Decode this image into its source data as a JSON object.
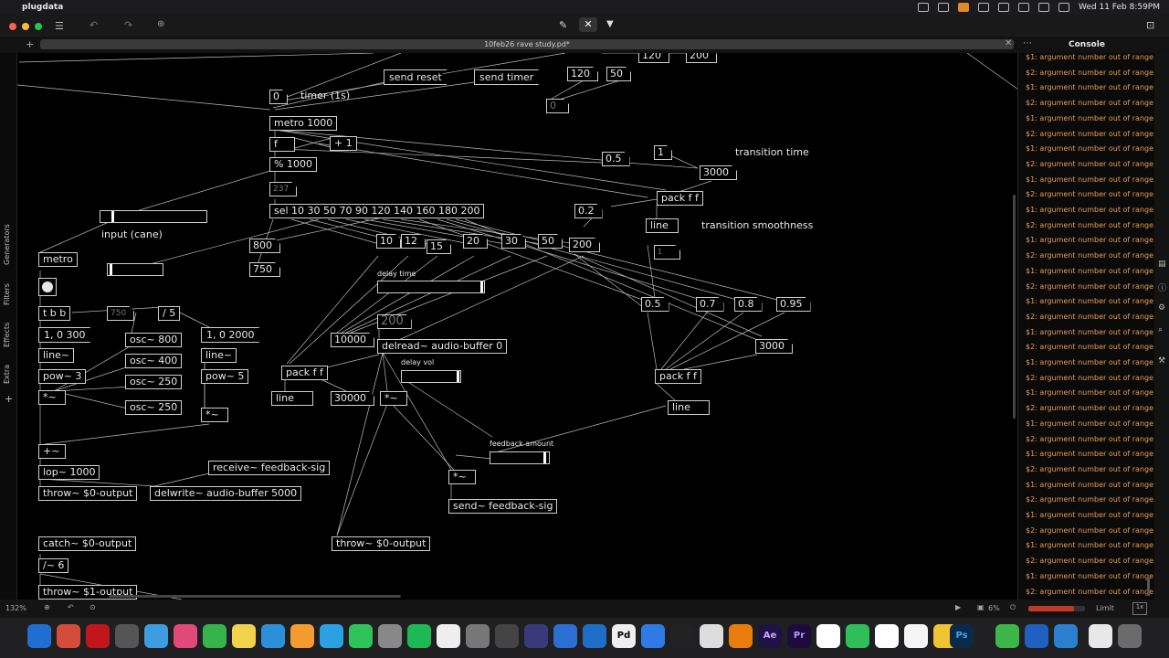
{
  "menubar": {
    "app_name": "plugdata",
    "datetime": "Wed 11 Feb  8:59PM"
  },
  "window": {
    "title": "10feb26 rave study.pd*",
    "console_title": "Console"
  },
  "sidebar": {
    "tabs": [
      "Generators",
      "Filters",
      "Effects",
      "Extra"
    ],
    "add_label": "+"
  },
  "patch": {
    "objects": [
      {
        "t": "msg",
        "text": "send reset"
      },
      {
        "t": "msg",
        "text": "send timer"
      },
      {
        "t": "num",
        "text": "120"
      },
      {
        "t": "num",
        "text": "50"
      },
      {
        "t": "num",
        "text": "120"
      },
      {
        "t": "num",
        "text": "200"
      },
      {
        "t": "num",
        "text": "0"
      },
      {
        "t": "num",
        "text": "0"
      },
      {
        "t": "cmt",
        "text": "timer (1s)"
      },
      {
        "t": "obj",
        "text": "metro 1000"
      },
      {
        "t": "obj",
        "text": "f"
      },
      {
        "t": "obj",
        "text": "+ 1"
      },
      {
        "t": "obj",
        "text": "% 1000"
      },
      {
        "t": "num",
        "text": "237"
      },
      {
        "t": "obj",
        "text": "sel 10 30 50 70 90 120 140 160 180 200"
      },
      {
        "t": "num",
        "text": "0.5"
      },
      {
        "t": "num",
        "text": "1"
      },
      {
        "t": "cmt",
        "text": "transition time"
      },
      {
        "t": "num",
        "text": "3000"
      },
      {
        "t": "obj",
        "text": "pack f f"
      },
      {
        "t": "num",
        "text": "0.2"
      },
      {
        "t": "obj",
        "text": "line"
      },
      {
        "t": "cmt",
        "text": "transition smoothness"
      },
      {
        "t": "num",
        "text": "1"
      },
      {
        "t": "cmt",
        "text": "input (cane)"
      },
      {
        "t": "obj",
        "text": "metro"
      },
      {
        "t": "num",
        "text": "800"
      },
      {
        "t": "num",
        "text": "750"
      },
      {
        "t": "num",
        "text": "10"
      },
      {
        "t": "num",
        "text": "12"
      },
      {
        "t": "num",
        "text": "15"
      },
      {
        "t": "num",
        "text": "20"
      },
      {
        "t": "num",
        "text": "30"
      },
      {
        "t": "num",
        "text": "50"
      },
      {
        "t": "num",
        "text": "200"
      },
      {
        "t": "cmt",
        "text": "delay time"
      },
      {
        "t": "obj",
        "text": "t b b"
      },
      {
        "t": "num",
        "text": "750"
      },
      {
        "t": "obj",
        "text": "/ 5"
      },
      {
        "t": "msg",
        "text": "1, 0 300"
      },
      {
        "t": "obj",
        "text": "osc~ 800"
      },
      {
        "t": "msg",
        "text": "1, 0 2000"
      },
      {
        "t": "obj",
        "text": "line~"
      },
      {
        "t": "obj",
        "text": "osc~ 400"
      },
      {
        "t": "obj",
        "text": "line~"
      },
      {
        "t": "obj",
        "text": "pow~ 3"
      },
      {
        "t": "obj",
        "text": "osc~ 250"
      },
      {
        "t": "obj",
        "text": "pow~ 5"
      },
      {
        "t": "obj",
        "text": "*~"
      },
      {
        "t": "obj",
        "text": "osc~ 250"
      },
      {
        "t": "obj",
        "text": "*~"
      },
      {
        "t": "num",
        "text": "200"
      },
      {
        "t": "num",
        "text": "10000"
      },
      {
        "t": "obj",
        "text": "delread~ audio-buffer 0"
      },
      {
        "t": "cmt",
        "text": "delay vol"
      },
      {
        "t": "obj",
        "text": "pack f f"
      },
      {
        "t": "obj",
        "text": "line"
      },
      {
        "t": "num",
        "text": "30000"
      },
      {
        "t": "obj",
        "text": "*~"
      },
      {
        "t": "num",
        "text": "0.5"
      },
      {
        "t": "num",
        "text": "0.7"
      },
      {
        "t": "num",
        "text": "0.8"
      },
      {
        "t": "num",
        "text": "0.95"
      },
      {
        "t": "num",
        "text": "3000"
      },
      {
        "t": "obj",
        "text": "pack f f"
      },
      {
        "t": "obj",
        "text": "line"
      },
      {
        "t": "obj",
        "text": "+~"
      },
      {
        "t": "cmt",
        "text": "feedback amount"
      },
      {
        "t": "obj",
        "text": "lop~ 1000"
      },
      {
        "t": "obj",
        "text": "receive~ feedback-sig"
      },
      {
        "t": "obj",
        "text": "*~"
      },
      {
        "t": "obj",
        "text": "throw~ $0-output"
      },
      {
        "t": "obj",
        "text": "delwrite~ audio-buffer 5000"
      },
      {
        "t": "obj",
        "text": "send~ feedback-sig"
      },
      {
        "t": "obj",
        "text": "catch~ $0-output"
      },
      {
        "t": "obj",
        "text": "throw~ $0-output"
      },
      {
        "t": "obj",
        "text": "/~ 6"
      },
      {
        "t": "obj",
        "text": "throw~ $1-output"
      }
    ]
  },
  "console": {
    "messages": [
      "$1: argument number out of range",
      "$2: argument number out of range",
      "$1: argument number out of range",
      "$2: argument number out of range",
      "$1: argument number out of range",
      "$2: argument number out of range",
      "$1: argument number out of range",
      "$2: argument number out of range",
      "$1: argument number out of range",
      "$2: argument number out of range",
      "$1: argument number out of range",
      "$2: argument number out of range",
      "$1: argument number out of range",
      "$2: argument number out of range",
      "$1: argument number out of range",
      "$2: argument number out of range",
      "$1: argument number out of range",
      "$2: argument number out of range",
      "$1: argument number out of range",
      "$2: argument number out of range",
      "$1: argument number out of range",
      "$2: argument number out of range",
      "$1: argument number out of range",
      "$2: argument number out of range",
      "$1: argument number out of range",
      "$2: argument number out of range",
      "$1: argument number out of range",
      "$2: argument number out of range",
      "$1: argument number out of range",
      "$2: argument number out of range",
      "$1: argument number out of range",
      "$2: argument number out of range",
      "$1: argument number out of range",
      "$2: argument number out of range",
      "$1: argument number out of range",
      "$2: argument number out of range"
    ],
    "message_color": "#e89b53"
  },
  "statusbar": {
    "zoom": "132%",
    "cpu": "6%",
    "limit_label": "Limit"
  },
  "dock": {
    "text_icons": [
      "Ae",
      "Pr",
      "Ps",
      "Pd"
    ]
  }
}
